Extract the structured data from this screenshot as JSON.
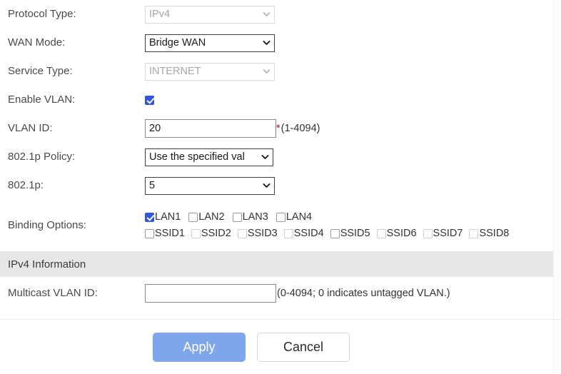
{
  "form": {
    "rows": [
      {
        "id": "protocol-type",
        "label": "Protocol Type:",
        "control": "select",
        "value": "IPv4",
        "disabled": true
      },
      {
        "id": "wan-mode",
        "label": "WAN Mode:",
        "control": "select",
        "value": "Bridge WAN",
        "disabled": false
      },
      {
        "id": "service-type",
        "label": "Service Type:",
        "control": "select",
        "value": "INTERNET",
        "disabled": true
      },
      {
        "id": "enable-vlan",
        "label": "Enable VLAN:",
        "control": "checkbox",
        "checked": true
      },
      {
        "id": "vlan-id",
        "label": "VLAN ID:",
        "control": "text",
        "value": "20",
        "placeholder": "",
        "required_mark": "*",
        "hint": "(1-4094)"
      },
      {
        "id": "dot1p-policy",
        "label": "802.1p Policy:",
        "control": "select",
        "value": "Use the specified val",
        "disabled": false
      },
      {
        "id": "dot1p",
        "label": "802.1p:",
        "control": "select",
        "value": "5",
        "disabled": false
      }
    ],
    "binding": {
      "label": "Binding Options:",
      "lan": [
        {
          "name": "LAN1",
          "checked": true
        },
        {
          "name": "LAN2",
          "checked": false
        },
        {
          "name": "LAN3",
          "checked": false
        },
        {
          "name": "LAN4",
          "checked": false
        }
      ],
      "ssid": [
        {
          "name": "SSID1",
          "checked": false,
          "faint": false
        },
        {
          "name": "SSID2",
          "checked": false,
          "faint": true
        },
        {
          "name": "SSID3",
          "checked": false,
          "faint": true
        },
        {
          "name": "SSID4",
          "checked": false,
          "faint": true
        },
        {
          "name": "SSID5",
          "checked": false,
          "faint": false
        },
        {
          "name": "SSID6",
          "checked": false,
          "faint": true
        },
        {
          "name": "SSID7",
          "checked": false,
          "faint": true
        },
        {
          "name": "SSID8",
          "checked": false,
          "faint": true
        }
      ]
    }
  },
  "section": {
    "title": "IPv4 Information",
    "multicast": {
      "label": "Multicast VLAN ID:",
      "value": "",
      "placeholder": "",
      "hint": "(0-4094; 0 indicates untagged VLAN.)"
    }
  },
  "actions": {
    "apply_label": "Apply",
    "cancel_label": "Cancel"
  },
  "colors": {
    "accent_blue": "#7ea6ec",
    "checkbox_blue": "#3355dd",
    "required_red": "#8c1b35",
    "band_gray": "#e7e7e7"
  }
}
